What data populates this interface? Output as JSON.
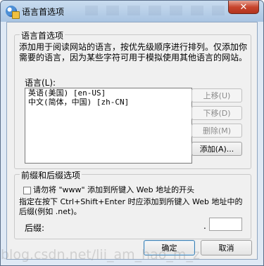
{
  "window": {
    "title": "语言首选项",
    "close_glyph": "✕"
  },
  "language_group": {
    "title": "语言首选项",
    "description": "添加用于阅读网站的语言，按优先级顺序进行排列。仅添加你需要的语言，因为某些字符可用于模拟使用其他语言的网站。",
    "list_label": "语言(L):",
    "languages": [
      {
        "name": "英语(美国)",
        "code": "[en-US]"
      },
      {
        "name": "中文(简体，中国)",
        "code": "[zh-CN]"
      }
    ],
    "buttons": {
      "move_up": "上移(U)",
      "move_down": "下移(D)",
      "remove": "删除(M)",
      "add": "添加(A)..."
    }
  },
  "prefix_group": {
    "title": "前缀和后缀选项",
    "checkbox_label": "请勿将 \"www\" 添加到所键入 Web 地址的开头",
    "suffix_description": "指定在按下 Ctrl+Shift+Enter 时应添加到所键入 Web 地址中的后缀(例如 .net)。",
    "suffix_label": "后缀:",
    "suffix_dot": ".",
    "suffix_value": ""
  },
  "footer": {
    "ok": "确定",
    "cancel": "取消"
  },
  "watermark": "blog.csdn.net/lii_am_hao_m_z"
}
